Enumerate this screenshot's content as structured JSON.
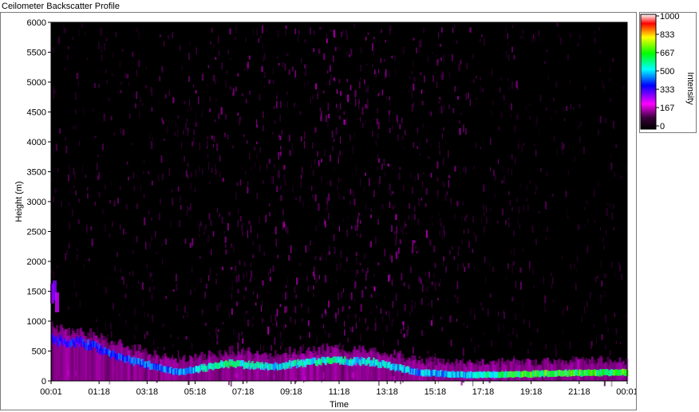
{
  "window": {
    "title": "Ceilometer Backscatter Profile"
  },
  "chart_data": {
    "type": "heatmap",
    "title": "Ceilometer Backscatter Profile",
    "xlabel": "Time",
    "ylabel": "Height (m)",
    "x_ticks": [
      "00:01",
      "01:18",
      "03:18",
      "05:18",
      "07:18",
      "09:18",
      "11:18",
      "13:18",
      "15:18",
      "17:18",
      "19:18",
      "21:18",
      "00:01"
    ],
    "y_ticks": [
      0,
      500,
      1000,
      1500,
      2000,
      2500,
      3000,
      3500,
      4000,
      4500,
      5000,
      5500,
      6000
    ],
    "ylim": [
      0,
      6000
    ],
    "colorbar": {
      "label": "Intensity",
      "ticks": [
        1000,
        833,
        667,
        500,
        333,
        167,
        0
      ],
      "range": [
        0,
        1000
      ],
      "colors": [
        "#000000",
        "#ff00ff",
        "#0000ff",
        "#00ffff",
        "#00ff00",
        "#ffff00",
        "#ff0000",
        "#ffffff"
      ]
    },
    "layer": {
      "description_series": "main boundary layer height",
      "time": [
        "00:01",
        "01:18",
        "03:18",
        "05:18",
        "07:18",
        "09:18",
        "11:18",
        "13:18",
        "15:18",
        "17:18",
        "19:18",
        "21:18",
        "00:01"
      ],
      "height": [
        700,
        650,
        350,
        150,
        300,
        250,
        350,
        330,
        150,
        110,
        120,
        140,
        150
      ],
      "peak_intensity": [
        350,
        380,
        420,
        450,
        600,
        500,
        560,
        520,
        480,
        500,
        640,
        640,
        650
      ]
    },
    "upper_layer": {
      "time": [
        "00:01",
        "00:07",
        "00:13"
      ],
      "height": [
        1550,
        1600,
        1400
      ],
      "intensity": [
        280,
        300,
        250
      ]
    },
    "grid": false,
    "legend": "none"
  }
}
